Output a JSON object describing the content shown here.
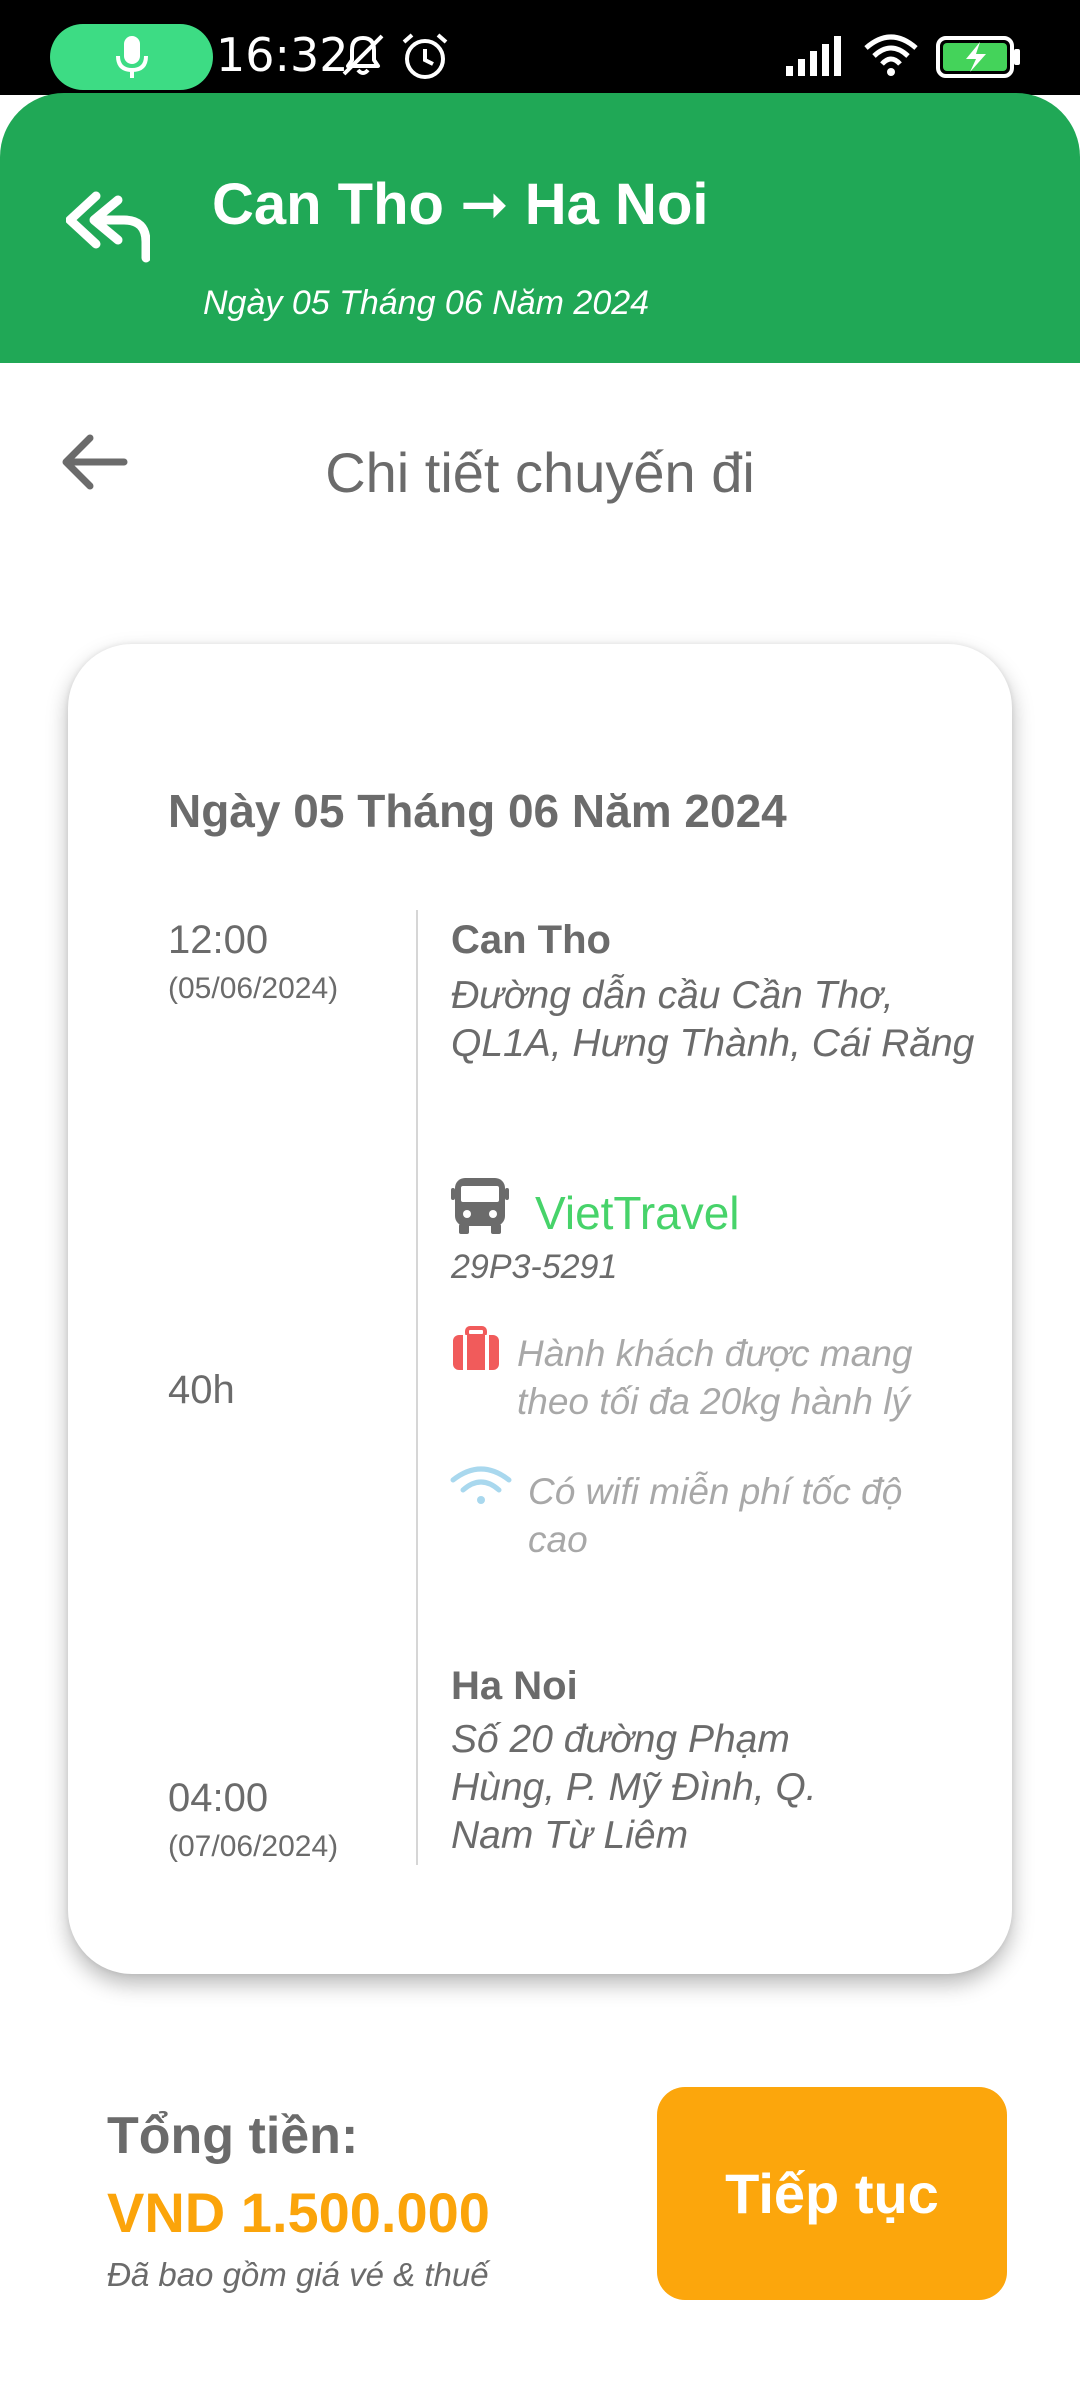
{
  "status_bar": {
    "time": "16:32",
    "icons": [
      "microphone-icon",
      "bell-off-icon",
      "alarm-icon",
      "signal-icon",
      "wifi-icon",
      "battery-charging-icon"
    ],
    "accent_color": "#3ddc84"
  },
  "header": {
    "route": "Can Tho ➞ Ha Noi",
    "date": "Ngày 05 Tháng 06 Năm 2024",
    "back_icon": "double-reply-arrow-icon",
    "color": "#20a856"
  },
  "page": {
    "title": "Chi tiết chuyến đi",
    "back_icon": "back-arrow-icon"
  },
  "trip": {
    "date": "Ngày 05 Tháng 06 Năm 2024",
    "departure": {
      "time": "12:00",
      "date": "(05/06/2024)",
      "city": "Can Tho",
      "address": "Đường dẫn cầu Cần Thơ, QL1A, Hưng Thành, Cái Răng"
    },
    "duration": "40h",
    "operator": {
      "name": "VietTravel",
      "plate": "29P3-5291",
      "icon": "bus-icon"
    },
    "amenities": [
      {
        "icon": "luggage-icon",
        "text": "Hành khách được mang theo tối đa 20kg hành lý"
      },
      {
        "icon": "wifi-icon",
        "text": "Có wifi miễn phí tốc độ cao"
      }
    ],
    "arrival": {
      "time": "04:00",
      "date": "(07/06/2024)",
      "city": "Ha Noi",
      "address": "Số 20 đường Phạm Hùng, P. Mỹ Đình, Q. Nam Từ Liêm"
    }
  },
  "footer": {
    "total_label": "Tổng tiền:",
    "total_price": "VND 1.500.000",
    "note": "Đã bao gồm giá vé & thuế",
    "continue_label": "Tiếp tục",
    "price_color": "#fba40a",
    "button_color": "#fca60c"
  }
}
